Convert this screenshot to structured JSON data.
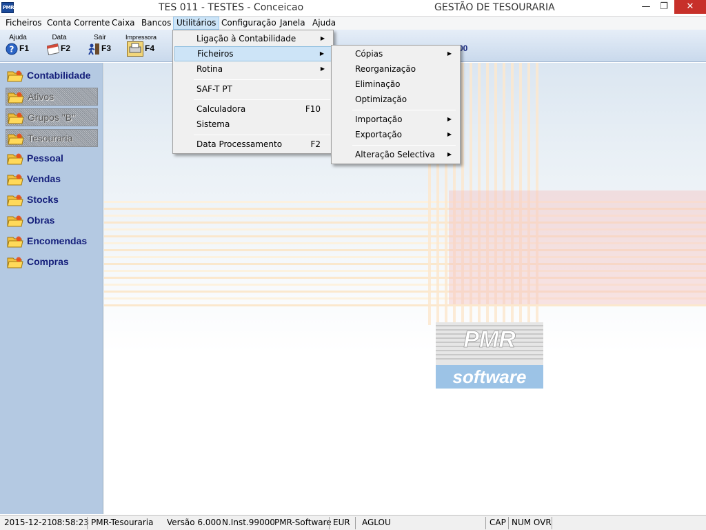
{
  "titlebar": {
    "title": "TES 011 - TESTES - Conceicao",
    "module": "GESTÃO DE TESOURARIA",
    "app_icon_text": "PMR",
    "minimize_glyph": "—",
    "restore_glyph": "❐",
    "close_glyph": "✕"
  },
  "menubar": {
    "items": [
      {
        "label": "Ficheiros"
      },
      {
        "label": "Conta Corrente"
      },
      {
        "label": "Caixa"
      },
      {
        "label": "Bancos"
      },
      {
        "label": "Utilitários",
        "active": true
      },
      {
        "label": "Configuração"
      },
      {
        "label": "Janela"
      },
      {
        "label": "Ajuda"
      }
    ]
  },
  "toolbar": {
    "buttons": [
      {
        "label": "Ajuda",
        "key": "F1",
        "icon": "help-icon"
      },
      {
        "label": "Data",
        "key": "F2",
        "icon": "calendar-icon"
      },
      {
        "label": "Sair",
        "key": "F3",
        "icon": "exit-icon"
      },
      {
        "label": "Impressora",
        "key": "F4",
        "icon": "printer-icon"
      }
    ],
    "trailing_text": "00"
  },
  "sidebar": {
    "items": [
      {
        "label": "Contabilidade",
        "enabled": true
      },
      {
        "label": "Ativos",
        "enabled": false
      },
      {
        "label": "Grupos \"B\"",
        "enabled": false
      },
      {
        "label": "Tesouraria",
        "enabled": false
      },
      {
        "label": "Pessoal",
        "enabled": true
      },
      {
        "label": "Vendas",
        "enabled": true
      },
      {
        "label": "Stocks",
        "enabled": true
      },
      {
        "label": "Obras",
        "enabled": true
      },
      {
        "label": "Encomendas",
        "enabled": true
      },
      {
        "label": "Compras",
        "enabled": true
      }
    ]
  },
  "utilitarios_menu": {
    "items": [
      {
        "label": "Ligação à Contabilidade",
        "submenu": true
      },
      {
        "label": "Ficheiros",
        "submenu": true,
        "highlighted": true
      },
      {
        "label": "Rotina",
        "submenu": true
      },
      {
        "label": "SAF-T PT"
      },
      {
        "label": "Calculadora",
        "shortcut": "F10"
      },
      {
        "label": "Sistema"
      },
      {
        "label": "Data Processamento",
        "shortcut": "F2"
      }
    ]
  },
  "ficheiros_submenu": {
    "items": [
      {
        "label": "Cópias",
        "submenu": true
      },
      {
        "label": "Reorganização"
      },
      {
        "label": "Eliminação"
      },
      {
        "label": "Optimização"
      },
      {
        "label": "Importação",
        "submenu": true
      },
      {
        "label": "Exportação",
        "submenu": true
      },
      {
        "label": "Alteração Selectiva",
        "submenu": true
      }
    ]
  },
  "logo": {
    "text_top": "PMR",
    "text_bottom": "software"
  },
  "statusbar": {
    "date": "2015-12-21",
    "time": "08:58:23",
    "product": "PMR-Tesouraria",
    "version": "Versão  6.000",
    "installation": "N.Inst.99000",
    "company": "PMR-Software",
    "currency": "EUR",
    "user": "AGLOU",
    "cap": "CAP",
    "num_ovr": "NUM OVR"
  },
  "colors": {
    "sidebar_bg": "#b4c9e2",
    "sidebar_text": "#141e7a",
    "menu_highlight": "#cde4f7",
    "close_button": "#c7302a",
    "logo_blue": "#9cc3e6"
  }
}
